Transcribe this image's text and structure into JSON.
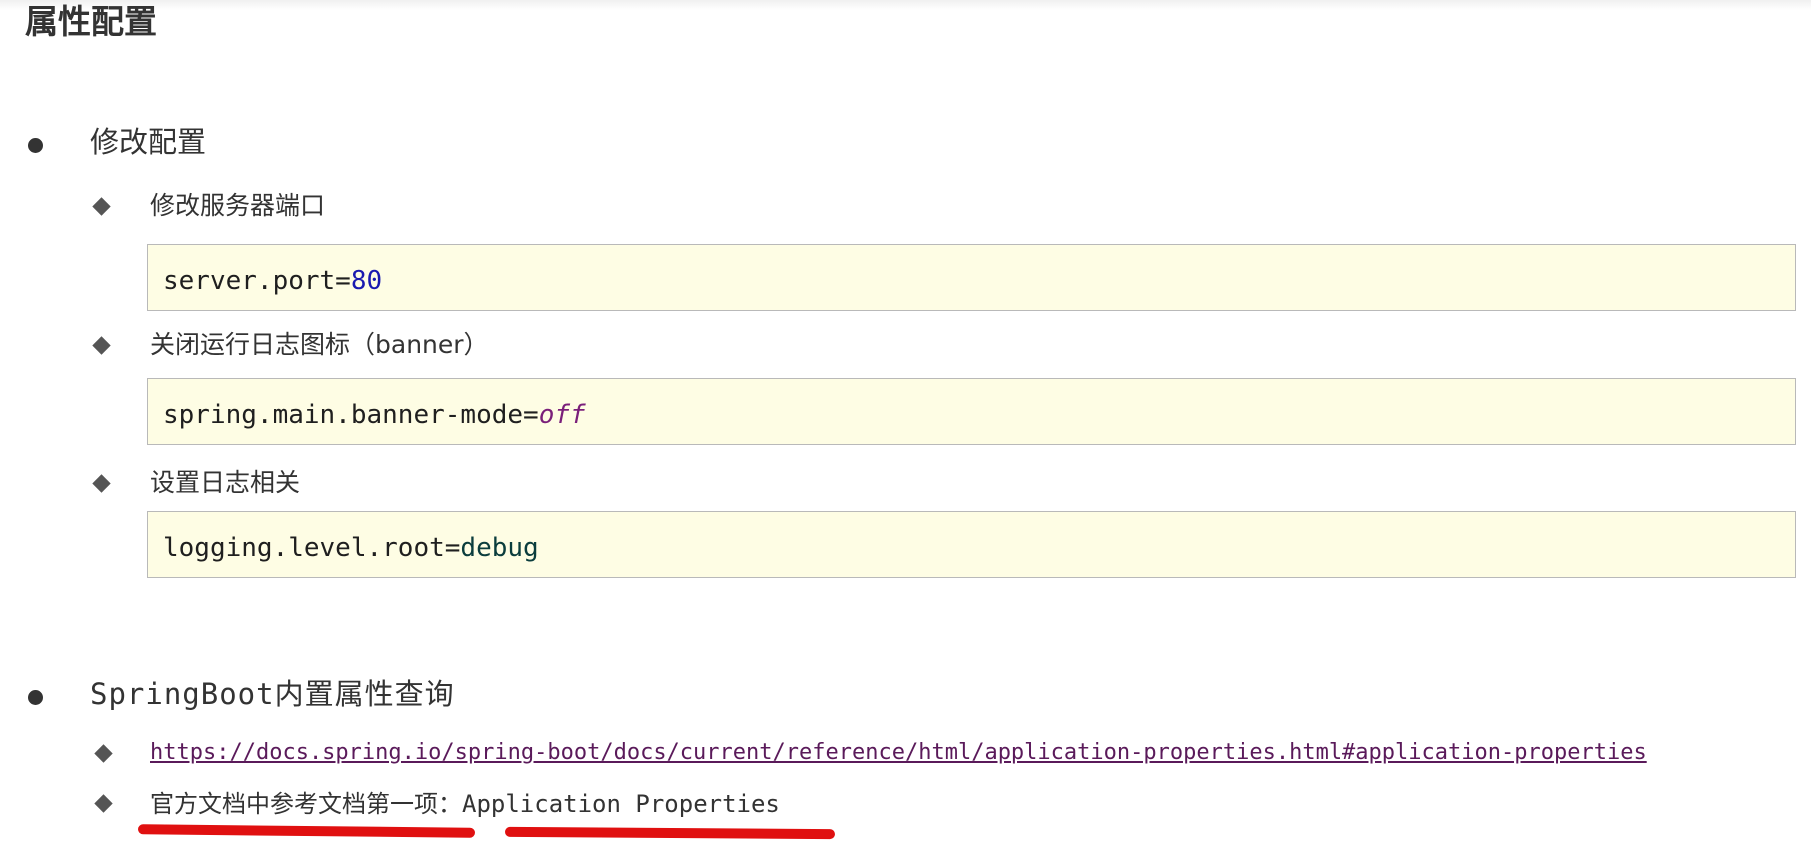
{
  "title": "属性配置",
  "sections": [
    {
      "heading": "修改配置",
      "items": [
        {
          "label": "修改服务器端口",
          "code": {
            "key": "server.port=",
            "value": "80"
          }
        },
        {
          "label": "关闭运行日志图标（banner）",
          "code": {
            "key": "spring.main.banner-mode=",
            "value": "off"
          }
        },
        {
          "label": "设置日志相关",
          "code": {
            "key": "logging.level.root=",
            "value": "debug"
          }
        }
      ]
    },
    {
      "heading": "SpringBoot内置属性查询",
      "link": "https://docs.spring.io/spring-boot/docs/current/reference/html/application-properties.html#application-properties",
      "note": {
        "prefix": "官方文档中参考文档第一项：",
        "value": "Application Properties"
      }
    }
  ],
  "colors": {
    "code_background": "#fefde4",
    "code_border": "#b9b9b9",
    "link_color": "#5a1a5a",
    "annotation_red": "#e01010",
    "number_token": "#1a1ab0",
    "keyword_token": "#7a1f7a"
  }
}
